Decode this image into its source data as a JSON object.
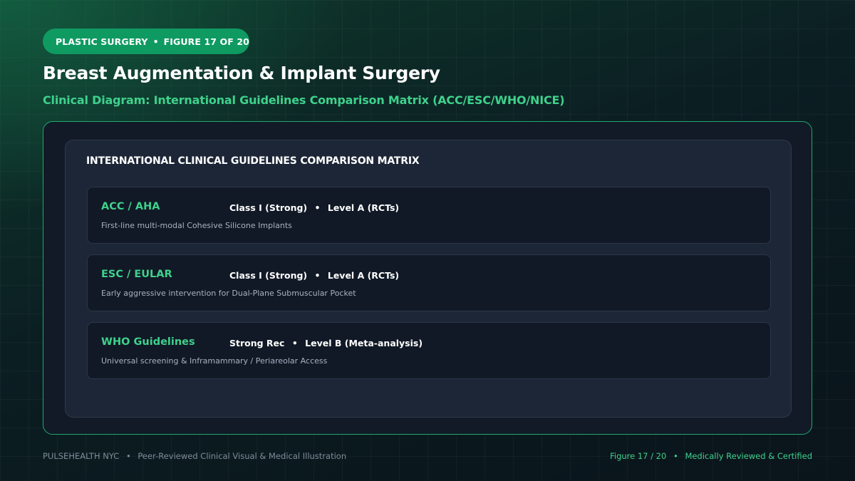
{
  "header": {
    "category": "PLASTIC SURGERY",
    "figure_label": "FIGURE 17 OF 20",
    "separator": "•",
    "title": "Breast Augmentation & Implant Surgery",
    "subtitle": "Clinical Diagram: International Guidelines Comparison Matrix (ACC/ESC/WHO/NICE)"
  },
  "matrix": {
    "title": "INTERNATIONAL CLINICAL GUIDELINES COMPARISON MATRIX",
    "rows": [
      {
        "name": "ACC / AHA",
        "strength": "Class I (Strong)",
        "evidence": "Level A (RCTs)",
        "description": "First-line multi-modal Cohesive Silicone Implants"
      },
      {
        "name": "ESC / EULAR",
        "strength": "Class I (Strong)",
        "evidence": "Level A (RCTs)",
        "description": "Early aggressive intervention for Dual-Plane Submuscular Pocket"
      },
      {
        "name": "WHO Guidelines",
        "strength": "Strong Rec",
        "evidence": "Level B (Meta-analysis)",
        "description": "Universal screening & Inframammary / Periareolar Access"
      }
    ]
  },
  "footer": {
    "brand": "PULSEHEALTH NYC",
    "tagline": "Peer-Reviewed Clinical Visual & Medical Illustration",
    "figure": "Figure 17 / 20",
    "certification": "Medically Reviewed & Certified"
  },
  "colors": {
    "accent": "#3fd18c",
    "pill": "#0f9a62",
    "border": "#22a86f"
  }
}
